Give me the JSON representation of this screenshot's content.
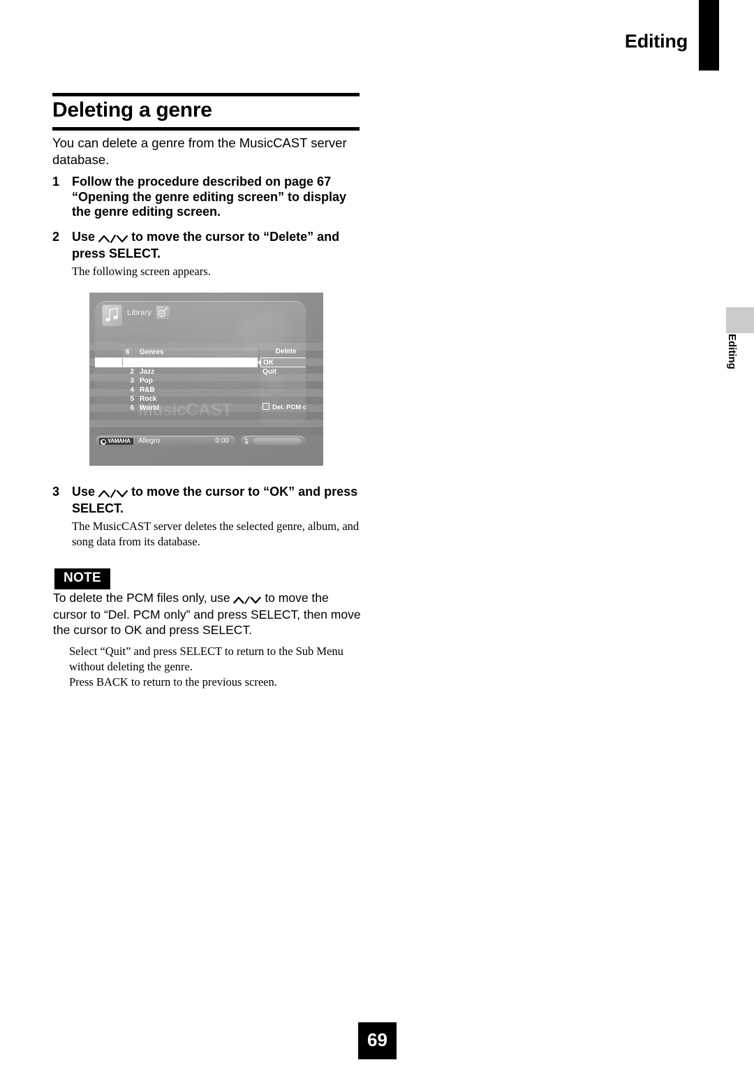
{
  "page": {
    "running_head": "Editing",
    "side_tab_label": "Editing",
    "page_number": "69"
  },
  "section": {
    "title": "Deleting a genre",
    "intro": "You can delete a genre from the MusicCAST server database."
  },
  "steps": [
    {
      "number": "1",
      "text": "Follow the procedure described on page 67 “Opening the genre editing screen” to display the genre editing screen.",
      "sub": ""
    },
    {
      "number": "2",
      "text_before": "Use",
      "text_after": "to move the cursor to “Delete” and press SELECT.",
      "sub": "The following screen appears."
    },
    {
      "number": "3",
      "text_before": "Use",
      "text_after": "to move the cursor to “OK” and press SELECT.",
      "sub": "The MusicCAST server deletes the selected genre, album, and song data from its database."
    }
  ],
  "note": {
    "badge": "NOTE",
    "body_before": "To delete the PCM files only, use",
    "body_after": "to move the cursor to “Del. PCM only” and press SELECT, then move the cursor to OK and press SELECT.",
    "sub_line1": "Select “Quit” and press SELECT to return to the Sub Menu without deleting the genre.",
    "sub_line2": "Press BACK to return to the previous screen."
  },
  "device_screen": {
    "header": {
      "library_label": "Library"
    },
    "watermark": "MusicCAST",
    "list": {
      "count_label": "6",
      "header_label": "Genres",
      "selected_index": 1,
      "rows": [
        {
          "num": "2",
          "name": "Jazz"
        },
        {
          "num": "3",
          "name": "Pop"
        },
        {
          "num": "4",
          "name": "R&B"
        },
        {
          "num": "5",
          "name": "Rock"
        },
        {
          "num": "6",
          "name": "World"
        }
      ]
    },
    "command_panel": {
      "title": "Delete",
      "ok_label": "OK",
      "quit_label": "Quit",
      "checkbox_label": "Del. PCM only",
      "checkbox_checked": false
    },
    "status_bar": {
      "brand": "YAMAHA",
      "track": "Allegro",
      "time": "0:00",
      "meter_left": "L",
      "meter_right": "R"
    }
  }
}
